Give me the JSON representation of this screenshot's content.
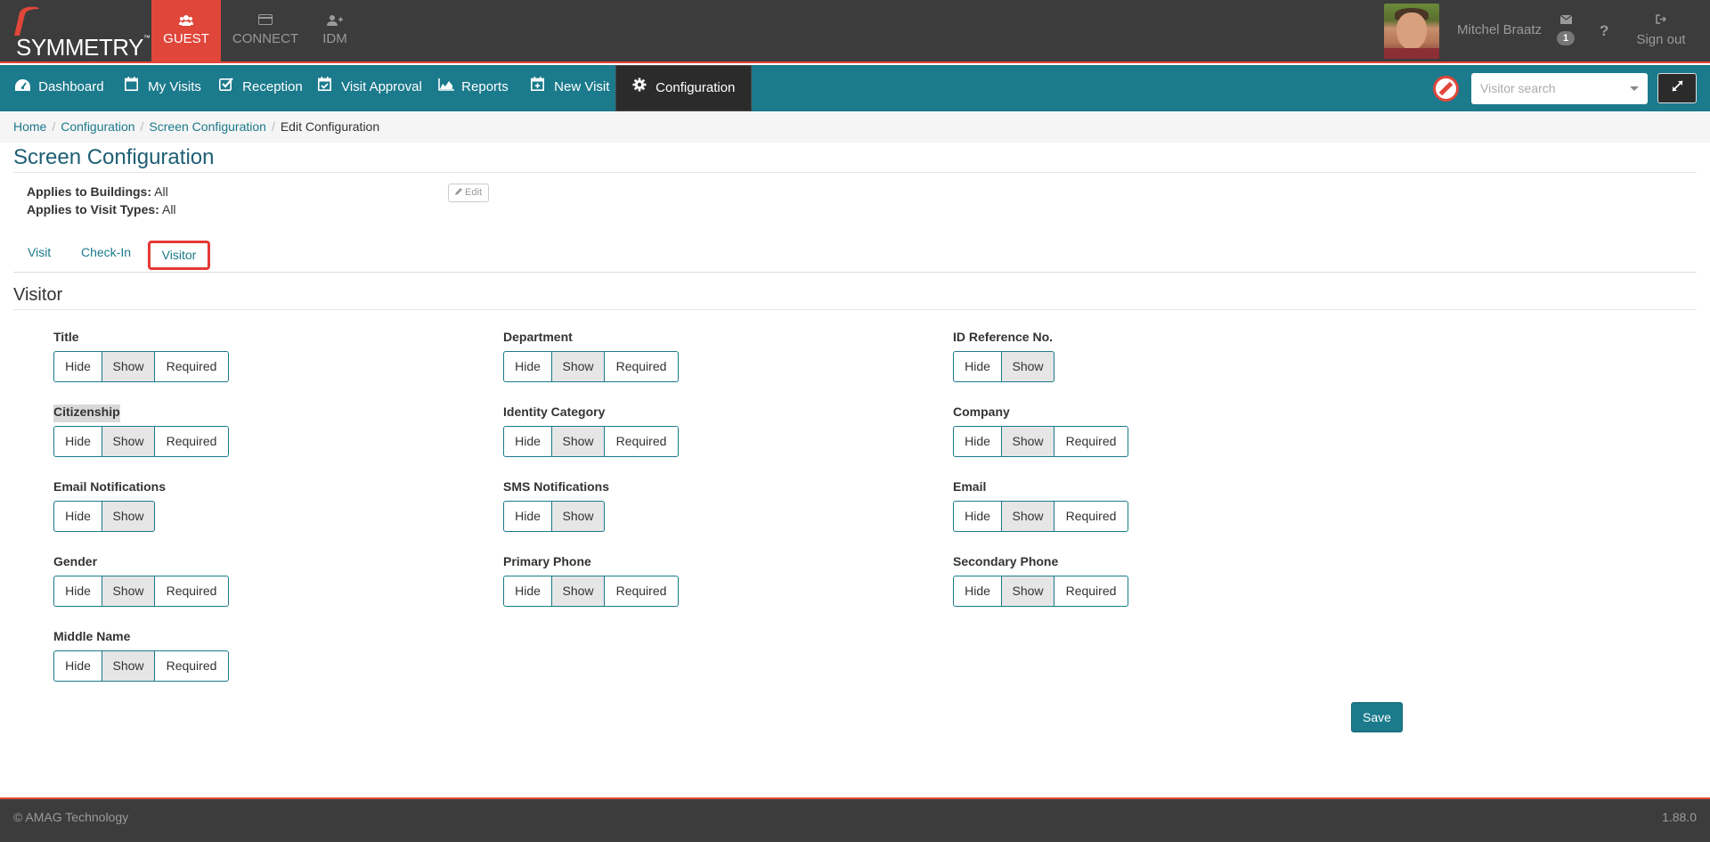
{
  "brand": {
    "logo_text": "SYMMETRY",
    "trademark": "™",
    "accent": "#e0463a",
    "nav_color": "#1b7a8c"
  },
  "app_tabs": [
    {
      "label": "GUEST",
      "icon": "group-icon",
      "active": true
    },
    {
      "label": "CONNECT",
      "icon": "card-icon",
      "active": false
    },
    {
      "label": "IDM",
      "icon": "user-plus-icon",
      "active": false
    }
  ],
  "user": {
    "name": "Mitchel Braatz",
    "messages_count": "1",
    "help": "?",
    "sign_out": "Sign out"
  },
  "nav": [
    {
      "label": "Dashboard",
      "icon": "dashboard-icon"
    },
    {
      "label": "My Visits",
      "icon": "calendar-icon"
    },
    {
      "label": "Reception",
      "icon": "check-square-icon"
    },
    {
      "label": "Visit Approval",
      "icon": "calendar-check-icon"
    },
    {
      "label": "Reports",
      "icon": "area-chart-icon"
    },
    {
      "label": "New Visit",
      "icon": "calendar-plus-icon"
    },
    {
      "label": "Configuration",
      "icon": "gear-icon",
      "active": true
    }
  ],
  "search": {
    "placeholder": "Visitor search"
  },
  "breadcrumb": {
    "home": "Home",
    "configuration": "Configuration",
    "screen_configuration": "Screen Configuration",
    "current": "Edit Configuration"
  },
  "page": {
    "title": "Screen Configuration",
    "applies_buildings_label": "Applies to Buildings:",
    "applies_buildings_value": "All",
    "applies_visit_types_label": "Applies to Visit Types:",
    "applies_visit_types_value": "All",
    "edit_label": "Edit"
  },
  "tabs": {
    "visit": "Visit",
    "check_in": "Check-In",
    "visitor": "Visitor",
    "active": "Visitor"
  },
  "section": {
    "title": "Visitor"
  },
  "options": {
    "hide": "Hide",
    "show": "Show",
    "required": "Required"
  },
  "fields": [
    {
      "label": "Title",
      "selected": "Show",
      "has_required": true
    },
    {
      "label": "Department",
      "selected": "Show",
      "has_required": true
    },
    {
      "label": "ID Reference No.",
      "selected": "Show",
      "has_required": false
    },
    {
      "label": "Citizenship",
      "selected": "Show",
      "has_required": true,
      "highlighted": true
    },
    {
      "label": "Identity Category",
      "selected": "Show",
      "has_required": true
    },
    {
      "label": "Company",
      "selected": "Show",
      "has_required": true
    },
    {
      "label": "Email Notifications",
      "selected": "Show",
      "has_required": false
    },
    {
      "label": "SMS Notifications",
      "selected": "Show",
      "has_required": false
    },
    {
      "label": "Email",
      "selected": "Show",
      "has_required": true
    },
    {
      "label": "Gender",
      "selected": "Show",
      "has_required": true
    },
    {
      "label": "Primary Phone",
      "selected": "Show",
      "has_required": true
    },
    {
      "label": "Secondary Phone",
      "selected": "Show",
      "has_required": true
    },
    {
      "label": "Middle Name",
      "selected": "Show",
      "has_required": true
    }
  ],
  "save_label": "Save",
  "footer": {
    "copyright": "© AMAG Technology",
    "version": "1.88.0"
  }
}
